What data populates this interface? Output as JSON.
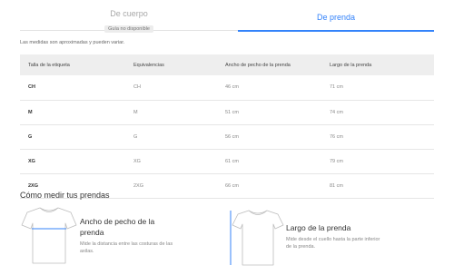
{
  "tabs": {
    "body": {
      "label": "De cuerpo",
      "badge": "Guía no disponible"
    },
    "garment": {
      "label": "De prenda"
    }
  },
  "note": "Las medidas son aproximadas y pueden variar.",
  "table": {
    "headers": [
      "Talla de la etiqueta",
      "Equivalencias",
      "Ancho de pecho de la prenda",
      "Largo de la prenda"
    ],
    "rows": [
      [
        "CH",
        "CH",
        "46 cm",
        "71 cm"
      ],
      [
        "M",
        "M",
        "51 cm",
        "74 cm"
      ],
      [
        "G",
        "G",
        "56 cm",
        "76 cm"
      ],
      [
        "XG",
        "XG",
        "61 cm",
        "79 cm"
      ],
      [
        "2XG",
        "2XG",
        "66 cm",
        "81 cm"
      ]
    ]
  },
  "howto": {
    "title": "Cómo medir tus prendas",
    "chest": {
      "title": "Ancho de pecho de la prenda",
      "description": "Mide la distancia entre las costuras de las axilas.",
      "icon": "tshirt-chest-icon"
    },
    "length": {
      "title": "Largo de la prenda",
      "description": "Mide desde el cuello hasta la parte inferior de la prenda.",
      "icon": "tshirt-length-icon"
    }
  },
  "colors": {
    "accent": "#3483fa",
    "header_bg": "#eeeeee"
  }
}
